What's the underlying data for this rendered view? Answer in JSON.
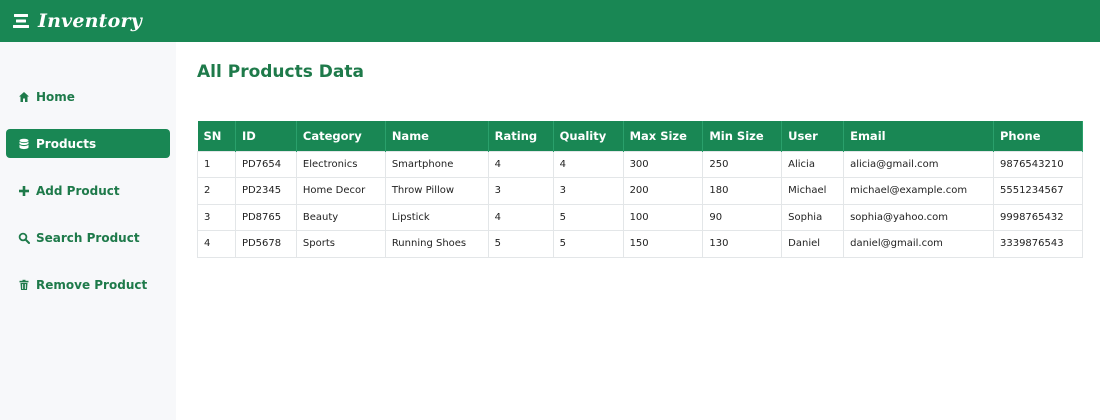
{
  "app": {
    "title": "Inventory"
  },
  "sidebar": {
    "items": [
      {
        "label": "Home",
        "icon": "home-icon",
        "active": false
      },
      {
        "label": "Products",
        "icon": "database-icon",
        "active": true
      },
      {
        "label": "Add Product",
        "icon": "plus-icon",
        "active": false
      },
      {
        "label": "Search Product",
        "icon": "search-icon",
        "active": false
      },
      {
        "label": "Remove Product",
        "icon": "trash-icon",
        "active": false
      }
    ]
  },
  "main": {
    "title": "All Products Data",
    "table": {
      "columns": [
        "SN",
        "ID",
        "Category",
        "Name",
        "Rating",
        "Quality",
        "Max Size",
        "Min Size",
        "User",
        "Email",
        "Phone"
      ],
      "rows": [
        [
          "1",
          "PD7654",
          "Electronics",
          "Smartphone",
          "4",
          "4",
          "300",
          "250",
          "Alicia",
          "alicia@gmail.com",
          "9876543210"
        ],
        [
          "2",
          "PD2345",
          "Home Decor",
          "Throw Pillow",
          "3",
          "3",
          "200",
          "180",
          "Michael",
          "michael@example.com",
          "5551234567"
        ],
        [
          "3",
          "PD8765",
          "Beauty",
          "Lipstick",
          "4",
          "5",
          "100",
          "90",
          "Sophia",
          "sophia@yahoo.com",
          "9998765432"
        ],
        [
          "4",
          "PD5678",
          "Sports",
          "Running Shoes",
          "5",
          "5",
          "150",
          "130",
          "Daniel",
          "daniel@gmail.com",
          "3339876543"
        ]
      ]
    }
  },
  "colors": {
    "primary": "#198754",
    "sidebar_bg": "#f7f8fa",
    "text_green": "#1e7a4a"
  }
}
